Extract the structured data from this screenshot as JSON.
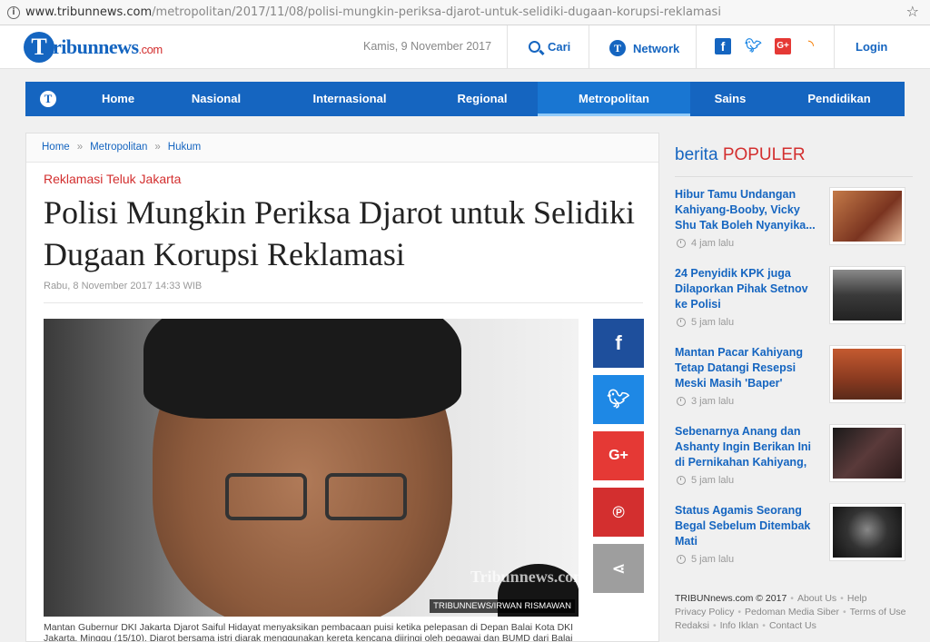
{
  "browser": {
    "url_domain": "www.tribunnews.com",
    "url_path": "/metropolitan/2017/11/08/polisi-mungkin-periksa-djarot-untuk-selidiki-dugaan-korupsi-reklamasi",
    "info_icon": "info-icon",
    "star_icon": "star-icon"
  },
  "header": {
    "logo_t": "T",
    "logo_main": "ribunnews",
    "logo_suffix": ".com",
    "date": "Kamis, 9 November 2017",
    "search_label": "Cari",
    "network_label": "Network",
    "login_label": "Login",
    "social_icons": [
      "facebook-icon",
      "twitter-icon",
      "google-plus-icon",
      "rss-icon"
    ]
  },
  "nav": {
    "items": [
      {
        "label": "Home"
      },
      {
        "label": "Nasional"
      },
      {
        "label": "Internasional"
      },
      {
        "label": "Regional"
      },
      {
        "label": "Metropolitan"
      },
      {
        "label": "Sains"
      },
      {
        "label": "Pendidikan"
      }
    ],
    "active": "Metropolitan"
  },
  "article": {
    "breadcrumb": [
      "Home",
      "Metropolitan",
      "Hukum"
    ],
    "kicker": "Reklamasi Teluk Jakarta",
    "title": "Polisi Mungkin Periksa Djarot untuk Selidiki Dugaan Korupsi Reklamasi",
    "published": "Rabu, 8 November 2017 14:33 WIB",
    "photo_watermark": "Tribunnews.com",
    "photo_credit": "TRIBUNNEWS/IRWAN RISMAWAN",
    "caption": "Mantan Gubernur DKI Jakarta Djarot Saiful Hidayat menyaksikan pembacaan puisi ketika pelepasan di Depan Balai Kota DKI Jakarta, Minggu (15/10). Djarot bersama istri diarak menggunakan kereta kencana diiringi oleh pegawai dan BUMD dari Balai Kota",
    "share": [
      "facebook-icon",
      "twitter-icon",
      "google-plus-icon",
      "pinterest-icon",
      "share-icon"
    ]
  },
  "sidebar": {
    "heading_prefix": "berita",
    "heading_main": "POPULER",
    "items": [
      {
        "title": "Hibur Tamu Undangan Kahiyang-Booby, Vicky Shu Tak Boleh Nyanyika...",
        "time": "4 jam lalu",
        "thumb": "#b0603a"
      },
      {
        "title": "24 Penyidik KPK juga Dilaporkan Pihak Setnov ke Polisi",
        "time": "5 jam lalu",
        "thumb": "#4a4a4a"
      },
      {
        "title": "Mantan Pacar Kahiyang Tetap Datangi Resepsi Meski Masih 'Baper'",
        "time": "3 jam lalu",
        "thumb": "#9c4a2a"
      },
      {
        "title": "Sebenarnya Anang dan Ashanty Ingin Berikan Ini di Pernikahan Kahiyang,",
        "time": "5 jam lalu",
        "thumb": "#3a2a2a"
      },
      {
        "title": "Status Agamis Seorang Begal Sebelum Ditembak Mati",
        "time": "5 jam lalu",
        "thumb": "#2a2a2a"
      }
    ],
    "footer_brand": "TRIBUNnews.com © 2017",
    "footer_links": [
      "About Us",
      "Help",
      "Privacy Policy",
      "Pedoman Media Siber",
      "Terms of Use",
      "Redaksi",
      "Info Iklan",
      "Contact Us"
    ]
  }
}
